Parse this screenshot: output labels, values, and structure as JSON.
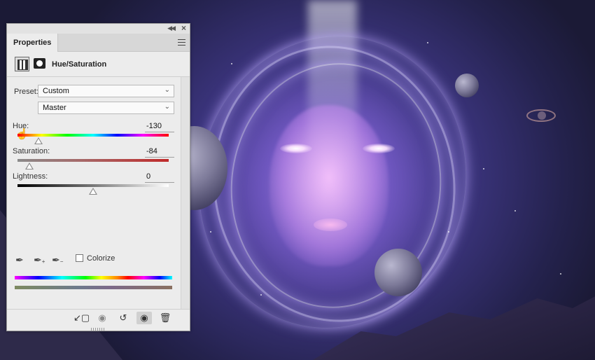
{
  "panel": {
    "tab_label": "Properties",
    "adjustment_title": "Hue/Saturation"
  },
  "preset": {
    "label": "Preset:",
    "value": "Custom"
  },
  "channel": {
    "value": "Master"
  },
  "hue": {
    "label": "Hue:",
    "value": "-130",
    "slider_fraction": 0.139
  },
  "saturation": {
    "label": "Saturation:",
    "value": "-84",
    "slider_fraction": 0.08
  },
  "lightness": {
    "label": "Lightness:",
    "value": "0",
    "slider_fraction": 0.5
  },
  "colorize": {
    "label": "Colorize",
    "checked": false
  },
  "icons": {
    "collapse": "double-chevron-left-icon",
    "close": "close-icon",
    "menu": "panel-menu-icon",
    "adjustment": "hue-saturation-adjustment-icon",
    "mask": "layer-mask-icon",
    "targeted_adjustment": "hand-targeted-adjustment-icon",
    "eyedropper": "eyedropper-icon",
    "eyedropper_add": "eyedropper-add-icon",
    "eyedropper_subtract": "eyedropper-subtract-icon",
    "clip": "clip-to-layer-icon",
    "view_previous": "view-previous-state-icon",
    "reset": "reset-icon",
    "visibility": "eye-icon",
    "delete": "trash-icon"
  },
  "colors": {
    "panel_bg": "#ececec",
    "hue_track_red": "#d92b2b",
    "saturation_track": "#c02a2a"
  }
}
